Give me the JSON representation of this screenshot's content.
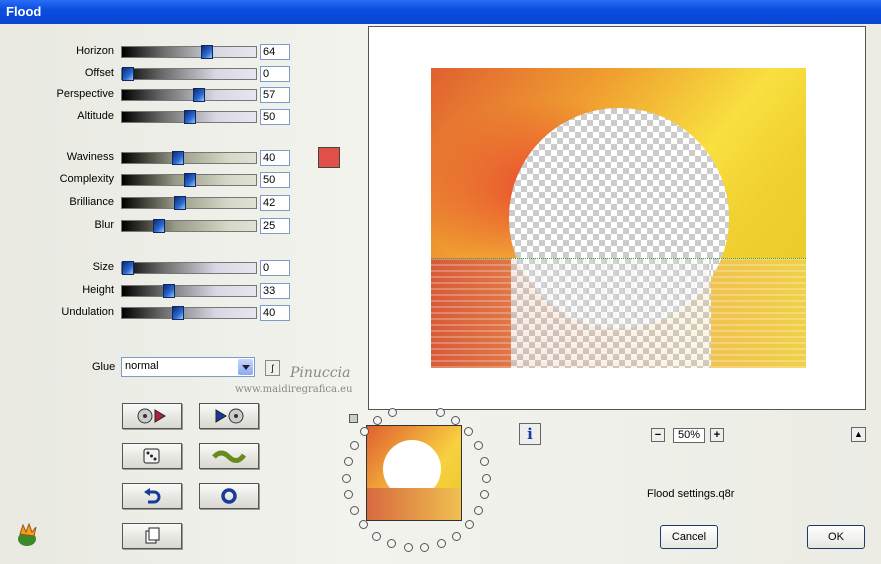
{
  "window": {
    "title": "Flood"
  },
  "sliders": [
    {
      "key": "horizon",
      "label": "Horizon",
      "value": "64",
      "pos": 0.64,
      "style": "g1"
    },
    {
      "key": "offset",
      "label": "Offset",
      "value": "0",
      "pos": 0.0,
      "style": "g1"
    },
    {
      "key": "perspective",
      "label": "Perspective",
      "value": "57",
      "pos": 0.57,
      "style": "g1"
    },
    {
      "key": "altitude",
      "label": "Altitude",
      "value": "50",
      "pos": 0.5,
      "style": "g1"
    },
    {
      "key": "waviness",
      "label": "Waviness",
      "value": "40",
      "pos": 0.4,
      "style": "g2"
    },
    {
      "key": "complexity",
      "label": "Complexity",
      "value": "50",
      "pos": 0.5,
      "style": "g2"
    },
    {
      "key": "brilliance",
      "label": "Brilliance",
      "value": "42",
      "pos": 0.42,
      "style": "g2"
    },
    {
      "key": "blur",
      "label": "Blur",
      "value": "25",
      "pos": 0.25,
      "style": "g2"
    },
    {
      "key": "size",
      "label": "Size",
      "value": "0",
      "pos": 0.0,
      "style": "g1"
    },
    {
      "key": "height",
      "label": "Height",
      "value": "33",
      "pos": 0.33,
      "style": "g1"
    },
    {
      "key": "undulation",
      "label": "Undulation",
      "value": "40",
      "pos": 0.4,
      "style": "g1"
    }
  ],
  "color_swatch": "#e05048",
  "glue": {
    "label": "Glue",
    "value": "normal"
  },
  "watermark": {
    "line1": "Pinuccia",
    "line2": "www.maidiregrafica.eu"
  },
  "zoom": {
    "value": "50%"
  },
  "settings_file": "Flood settings.q8r",
  "buttons": {
    "cancel": "Cancel",
    "ok": "OK"
  },
  "icons": {
    "info": "info-icon",
    "save_preset": "save-preset-icon",
    "load_preset": "load-preset-icon",
    "random": "dice-icon",
    "wave": "wave-icon",
    "undo": "undo-icon",
    "reset": "reset-icon",
    "copy": "copy-icon"
  }
}
